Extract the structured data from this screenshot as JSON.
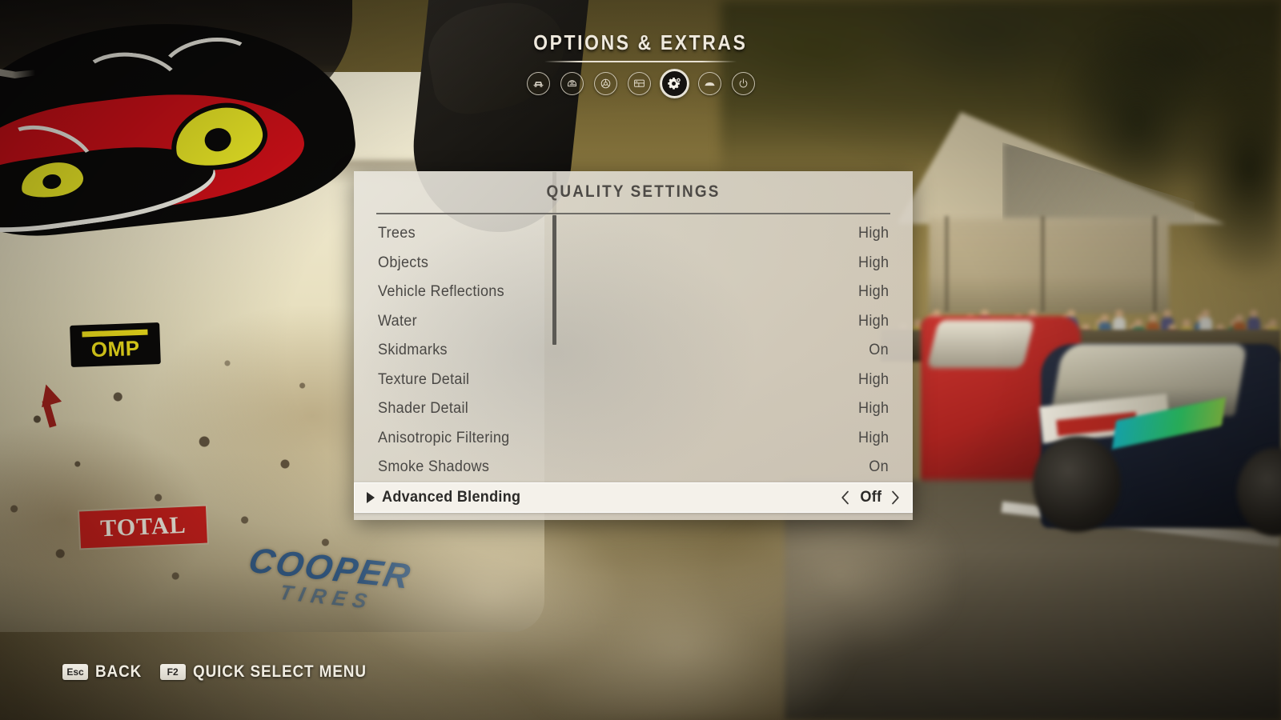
{
  "header": {
    "title": "OPTIONS & EXTRAS",
    "nav_icons": [
      {
        "name": "car-front-icon",
        "active": false
      },
      {
        "name": "helmet-icon",
        "active": false
      },
      {
        "name": "steering-wheel-icon",
        "active": false
      },
      {
        "name": "display-screen-icon",
        "active": false
      },
      {
        "name": "gear-settings-icon",
        "active": true
      },
      {
        "name": "car-side-icon",
        "active": false
      },
      {
        "name": "power-icon",
        "active": false
      }
    ]
  },
  "panel": {
    "title": "QUALITY SETTINGS",
    "rows": [
      {
        "label": "Trees",
        "value": "High",
        "selected": false
      },
      {
        "label": "Objects",
        "value": "High",
        "selected": false
      },
      {
        "label": "Vehicle Reflections",
        "value": "High",
        "selected": false
      },
      {
        "label": "Water",
        "value": "High",
        "selected": false
      },
      {
        "label": "Skidmarks",
        "value": "On",
        "selected": false
      },
      {
        "label": "Texture Detail",
        "value": "High",
        "selected": false
      },
      {
        "label": "Shader Detail",
        "value": "High",
        "selected": false
      },
      {
        "label": "Anisotropic Filtering",
        "value": "High",
        "selected": false
      },
      {
        "label": "Smoke Shadows",
        "value": "On",
        "selected": false
      },
      {
        "label": "Advanced Blending",
        "value": "Off",
        "selected": true
      }
    ]
  },
  "footer": {
    "hints": [
      {
        "key": "Esc",
        "label": "BACK"
      },
      {
        "key": "F2",
        "label": "QUICK SELECT MENU"
      }
    ]
  },
  "scene": {
    "hero_car_decals": {
      "omp": "OMP",
      "total": "TOTAL",
      "cooper_line1": "COOPER",
      "cooper_line2": "TIRES"
    }
  },
  "colors": {
    "panel_bg": "#e0dcd2",
    "panel_text": "#4a4845",
    "selected_row_bg": "#f4f1ea",
    "header_text": "#efe9dd",
    "accent_red": "#cf1018",
    "accent_yellow": "#edea26"
  }
}
